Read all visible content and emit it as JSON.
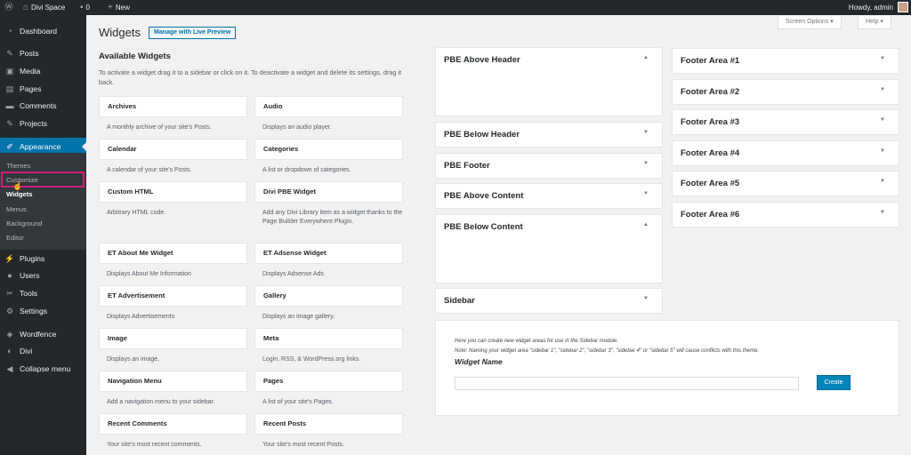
{
  "adminbar": {
    "wp_logo": "wordpress-icon",
    "site_name": "Divi Space",
    "comments_count": "0",
    "new_label": "New",
    "howdy": "Howdy, admin"
  },
  "sidemenu": {
    "items": [
      {
        "label": "Dashboard",
        "icon": "dashboard-icon"
      },
      {
        "label": "Posts",
        "icon": "pin-icon"
      },
      {
        "label": "Media",
        "icon": "media-icon"
      },
      {
        "label": "Pages",
        "icon": "pages-icon"
      },
      {
        "label": "Comments",
        "icon": "comment-icon"
      },
      {
        "label": "Projects",
        "icon": "pin-icon"
      },
      {
        "label": "Appearance",
        "icon": "brush-icon"
      },
      {
        "label": "Plugins",
        "icon": "plugin-icon"
      },
      {
        "label": "Users",
        "icon": "users-icon"
      },
      {
        "label": "Tools",
        "icon": "wrench-icon"
      },
      {
        "label": "Settings",
        "icon": "settings-icon"
      },
      {
        "label": "Wordfence",
        "icon": "wordfence-icon"
      },
      {
        "label": "Divi",
        "icon": "divi-icon"
      },
      {
        "label": "Collapse menu",
        "icon": "collapse-icon"
      }
    ],
    "submenu": [
      "Themes",
      "Customize",
      "Widgets",
      "Menus",
      "Background",
      "Editor"
    ]
  },
  "header": {
    "title": "Widgets",
    "preview_button": "Manage with Live Preview",
    "screen_options": "Screen Options ▾",
    "help": "Help ▾"
  },
  "available": {
    "title": "Available Widgets",
    "description": "To activate a widget drag it to a sidebar or click on it. To deactivate a widget and delete its settings, drag it back.",
    "widgets": [
      {
        "name": "Archives",
        "desc": "A monthly archive of your site's Posts."
      },
      {
        "name": "Audio",
        "desc": "Displays an audio player."
      },
      {
        "name": "Calendar",
        "desc": "A calendar of your site's Posts."
      },
      {
        "name": "Categories",
        "desc": "A list or dropdown of categories."
      },
      {
        "name": "Custom HTML",
        "desc": "Arbitrary HTML code."
      },
      {
        "name": "Divi PBE Widget",
        "desc": "Add any Divi Library item as a widget thanks to the Page Builder Everywhere Plugin."
      },
      {
        "name": "ET About Me Widget",
        "desc": "Displays About Me Information"
      },
      {
        "name": "ET Adsense Widget",
        "desc": "Displays Adsense Ads"
      },
      {
        "name": "ET Advertisement",
        "desc": "Displays Advertisements"
      },
      {
        "name": "Gallery",
        "desc": "Displays an image gallery."
      },
      {
        "name": "Image",
        "desc": "Displays an image."
      },
      {
        "name": "Meta",
        "desc": "Login, RSS, & WordPress.org links."
      },
      {
        "name": "Navigation Menu",
        "desc": "Add a navigation menu to your sidebar."
      },
      {
        "name": "Pages",
        "desc": "A list of your site's Pages."
      },
      {
        "name": "Recent Comments",
        "desc": "Your site's most recent comments."
      },
      {
        "name": "Recent Posts",
        "desc": "Your site's most recent Posts."
      }
    ]
  },
  "sidebars_left": [
    {
      "title": "PBE Above Header",
      "arrow": "▲"
    },
    {
      "title": "PBE Below Header",
      "arrow": "▼"
    },
    {
      "title": "PBE Footer",
      "arrow": "▼"
    },
    {
      "title": "PBE Above Content",
      "arrow": "▼"
    },
    {
      "title": "PBE Below Content",
      "arrow": "▲"
    },
    {
      "title": "Sidebar",
      "arrow": "▼"
    }
  ],
  "sidebars_right": [
    {
      "title": "Footer Area #1",
      "arrow": "▼"
    },
    {
      "title": "Footer Area #2",
      "arrow": "▼"
    },
    {
      "title": "Footer Area #3",
      "arrow": "▼"
    },
    {
      "title": "Footer Area #4",
      "arrow": "▼"
    },
    {
      "title": "Footer Area #5",
      "arrow": "▼"
    },
    {
      "title": "Footer Area #6",
      "arrow": "▼"
    }
  ],
  "create": {
    "info1": "Here you can create new widget areas for use in the Sidebar module.",
    "info2": "Note: Naming your widget area \"sidebar 1\", \"sidebar 2\", \"sidebar 3\", \"sidebar 4\" or \"sidebar 5\" will cause conflicts with this theme.",
    "name_label": "Widget Name",
    "input_value": "",
    "button": "Create"
  },
  "colors": {
    "accent": "#0073aa",
    "highlight": "#d11f7a",
    "adminbar": "#23282d"
  }
}
